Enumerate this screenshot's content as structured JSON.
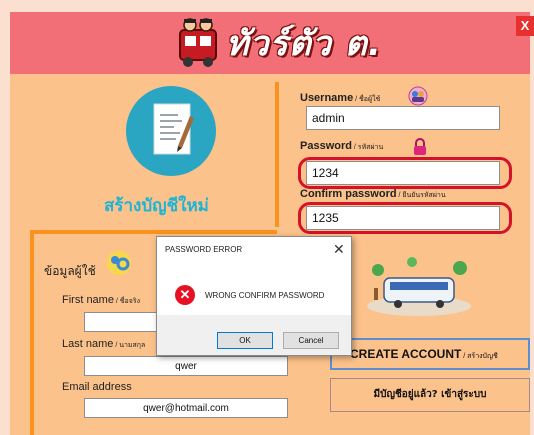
{
  "header": {
    "app_title": "ทัวร์ตัว ต.",
    "close_label": "X",
    "accent": "#f26f78"
  },
  "register": {
    "create_label": "สร้างบัญชีใหม่",
    "username_label": "Username",
    "username_label_th": " / ชื่อผู้ใช้",
    "username_value": "admin",
    "password_label": "Password",
    "password_label_th": " / รหัสผ่าน",
    "password_value": "1234",
    "confirm_label": "Confirm password",
    "confirm_label_th": " / ยืนยันรหัสผ่าน",
    "confirm_value": "1235"
  },
  "user_info": {
    "title": "ข้อมูลผู้ใช้",
    "first_name_label": "First name",
    "first_name_label_th": " / ชื่อจริง",
    "first_name_value": "",
    "last_name_label": "Last name",
    "last_name_label_th": " / นามสกุล",
    "last_name_value": "qwer",
    "email_label": "Email address",
    "email_value": "qwer@hotmail.com"
  },
  "actions": {
    "create_account": "CREATE ACCOUNT",
    "create_account_th": " / สร้างบัญชี",
    "login_link": "มีบัญชีอยู่แล้ว? เข้าสู่ระบบ"
  },
  "dialog": {
    "title": "PASSWORD ERROR",
    "close": "✕",
    "message": "WRONG CONFIRM PASSWORD",
    "ok": "OK",
    "cancel": "Cancel",
    "error_color": "#e81123"
  }
}
